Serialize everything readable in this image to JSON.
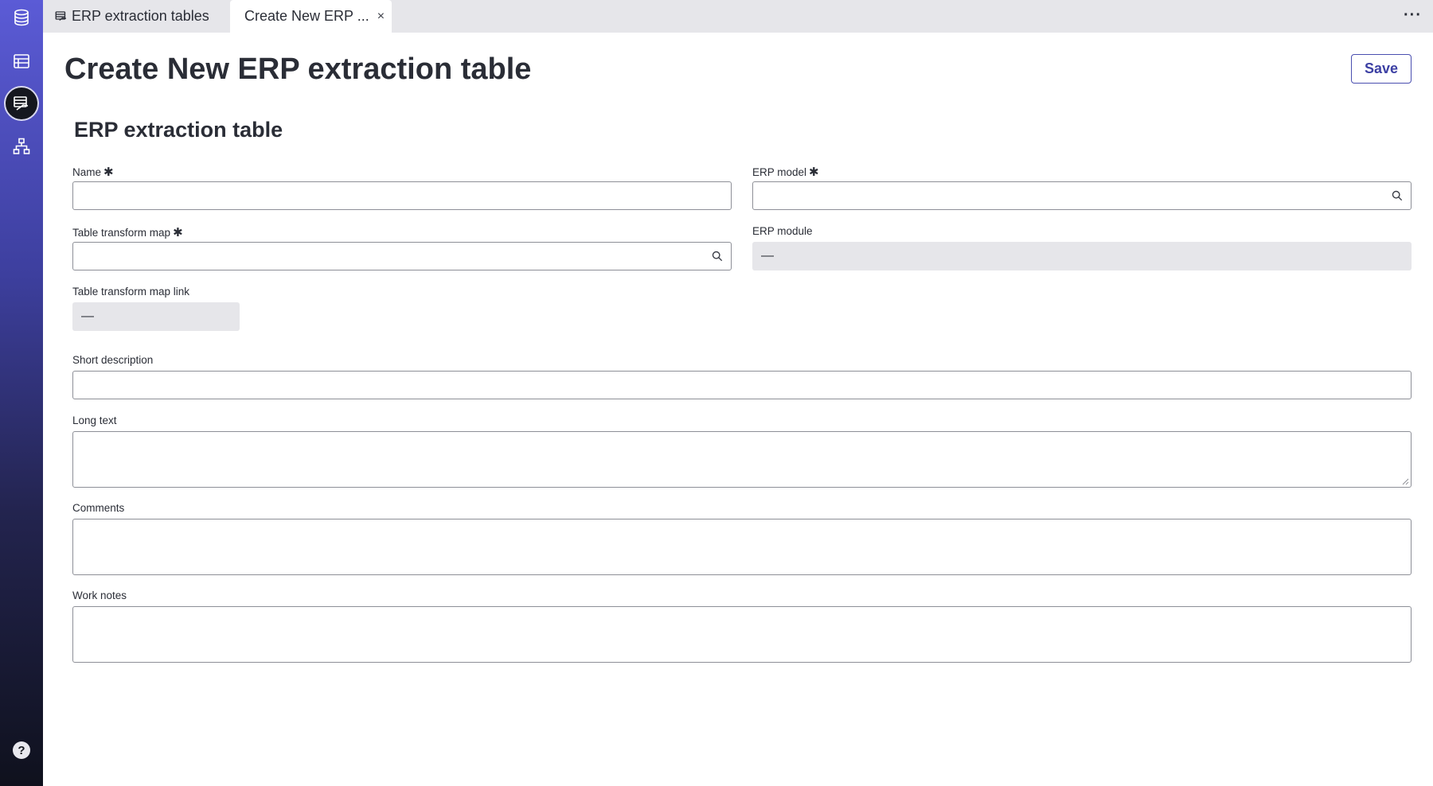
{
  "tabs": [
    {
      "label": "ERP extraction tables",
      "icon": "erp-table-icon"
    },
    {
      "label": "Create New ERP ...",
      "close": "×"
    }
  ],
  "more_label": "···",
  "page_title": "Create New ERP extraction table",
  "save_label": "Save",
  "section_title": "ERP extraction table",
  "fields": {
    "name": {
      "label": "Name",
      "required": "✱",
      "value": ""
    },
    "erp_model": {
      "label": "ERP model",
      "required": "✱",
      "value": ""
    },
    "table_transform_map": {
      "label": "Table transform map",
      "required": "✱",
      "value": ""
    },
    "erp_module": {
      "label": "ERP module",
      "value": "—"
    },
    "table_transform_map_link": {
      "label": "Table transform map link",
      "value": "—"
    },
    "short_description": {
      "label": "Short description",
      "value": ""
    },
    "long_text": {
      "label": "Long text",
      "value": ""
    },
    "comments": {
      "label": "Comments",
      "value": ""
    },
    "work_notes": {
      "label": "Work notes",
      "value": ""
    }
  },
  "sidebar": [
    "database-icon",
    "table-list-icon",
    "erp-table-icon",
    "org-chart-icon",
    "help-icon"
  ],
  "help_glyph": "?"
}
